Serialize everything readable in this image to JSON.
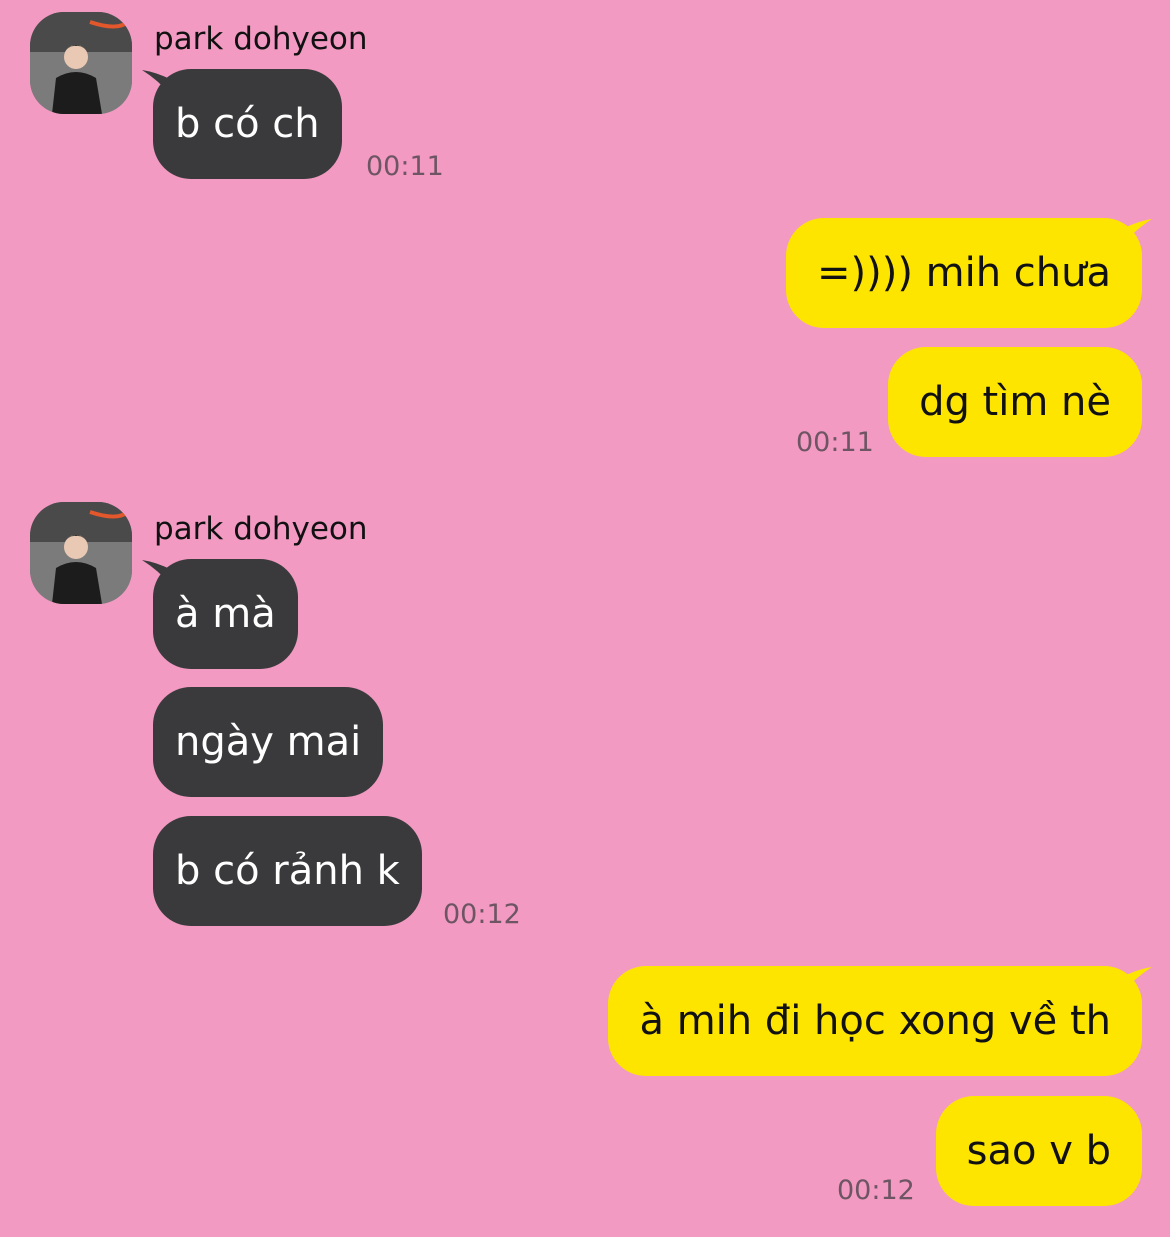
{
  "colors": {
    "background": "#f29ac2",
    "incoming_bubble": "#3a3a3c",
    "outgoing_bubble": "#fee500",
    "timestamp": "#6e5563"
  },
  "groups": [
    {
      "sender": "park dohyeon",
      "avatar_icon": "profile-photo",
      "messages": [
        "b có ch"
      ],
      "time": "00:11"
    },
    {
      "sender": "me",
      "messages": [
        "=)))) mih chưa",
        "dg tìm nè"
      ],
      "time": "00:11"
    },
    {
      "sender": "park dohyeon",
      "avatar_icon": "profile-photo",
      "messages": [
        "à mà",
        "ngày mai",
        "b có rảnh k"
      ],
      "time": "00:12"
    },
    {
      "sender": "me",
      "messages": [
        "à mih đi học xong về th",
        "sao v b"
      ],
      "time": "00:12"
    }
  ]
}
